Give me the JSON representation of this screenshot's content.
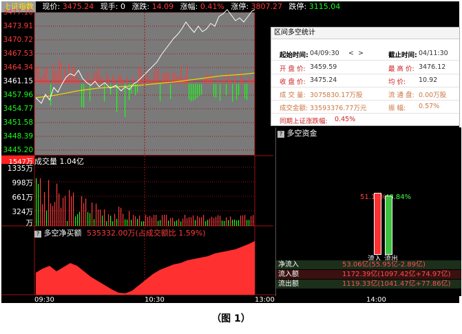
{
  "topbar": {
    "index_name": "上证指数",
    "price_label": "现价:",
    "price": "3475.24",
    "volume_label": "现手:",
    "volume": "0",
    "change_label": "涨跌:",
    "change": "14.09",
    "pct_label": "涨幅:",
    "pct": "0.41%",
    "limit_up_label": "涨停:",
    "limit_up": "3807.27",
    "limit_down_label": "跌停:",
    "limit_down": "3115.04"
  },
  "price_axis": [
    "3477.10",
    "3473.91",
    "3470.72",
    "3467.53",
    "3464.34",
    "3461.15",
    "3457.96",
    "3454.77",
    "3451.58",
    "3448.39",
    "3445.20"
  ],
  "volume_panel": {
    "badge": "1547万",
    "title": "成交量 1.04亿",
    "axis": [
      "1335万",
      "998万",
      "661万",
      "324万",
      "万"
    ]
  },
  "net_panel": {
    "title": "多空净买额",
    "value": "535332.00万(占成交额比 1.59%)"
  },
  "time_axis": [
    "09:30",
    "10:30",
    "13:00",
    "14:00"
  ],
  "popup": {
    "title": "区间多空统计",
    "start_label": "起始时间:",
    "start_value": "04/09:30",
    "nav_prev": "<",
    "nav_next": ">",
    "end_label": "截止时间:",
    "end_value": "04/11:30",
    "open_label": "开 盘 价:",
    "open_value": "3459.59",
    "high_label": "最 高 价:",
    "high_value": "3476.12",
    "close_label": "收 盘 价:",
    "close_value": "3475.24",
    "avg_label": "均    价:",
    "avg_value": "10.92",
    "vol_label": "成 交 量:",
    "vol_value": "3075830.17万股",
    "float_label": "流 通 盘:",
    "float_value": "0.00万股",
    "amount_label": "成交金额:",
    "amount_value": "33593376.77万元",
    "swing_label": "振    幅:",
    "swing_value": "0.57%",
    "period_label": "同期上证涨跌幅:",
    "period_value": "0.45%"
  },
  "money_flow": {
    "title": "多空资金",
    "inflow_pct": "51.16%",
    "outflow_pct": "48.84%",
    "inflow_ratio": 51.16,
    "outflow_ratio": 48.84,
    "in_label": "流入",
    "out_label": "流出",
    "rows": [
      {
        "name": "净流入",
        "value": "53.06亿(55.95亿-2.89亿)"
      },
      {
        "name": "流入额",
        "value": "1172.39亿(1097.42亿+74.97亿)"
      },
      {
        "name": "流出额",
        "value": "1119.33亿(1041.47亿+77.86亿)"
      }
    ]
  },
  "caption": "（图 1）",
  "colors": {
    "up": "#ff3b3b",
    "down": "#19ff19",
    "price_line": "#ffffff",
    "avg_line": "#e8d800",
    "chart_bg": "#7a7a7a",
    "grid_red": "#a01010"
  }
}
